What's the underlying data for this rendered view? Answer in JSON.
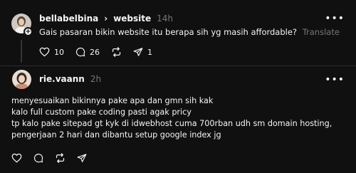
{
  "post": {
    "username": "bellabelbina",
    "separator": "›",
    "topic": "website",
    "time": "14h",
    "text": "Gais pasaran bikin website itu berapa sih yg masih affordable?",
    "translate_label": "Translate",
    "likes": "10",
    "comments": "26",
    "shares": "1"
  },
  "reply": {
    "username": "rie.vaann",
    "time": "2h",
    "lines": [
      "menyesuaikan bikinnya pake apa dan gmn sih kak",
      "kalo full custom pake coding pasti agak pricy",
      "tp kalo pake sitepad gt kyk di idwebhost cuma 700rban udh sm domain hosting,",
      "pengerjaan 2 hari dan dibantu setup google index jg"
    ]
  },
  "icons": {
    "more": "more-icon",
    "like": "heart-icon",
    "comment": "comment-icon",
    "repost": "repost-icon",
    "share": "send-icon",
    "follow": "plus-icon"
  },
  "colors": {
    "background": "#101010",
    "text": "#f3f5f7",
    "muted": "#777777"
  }
}
